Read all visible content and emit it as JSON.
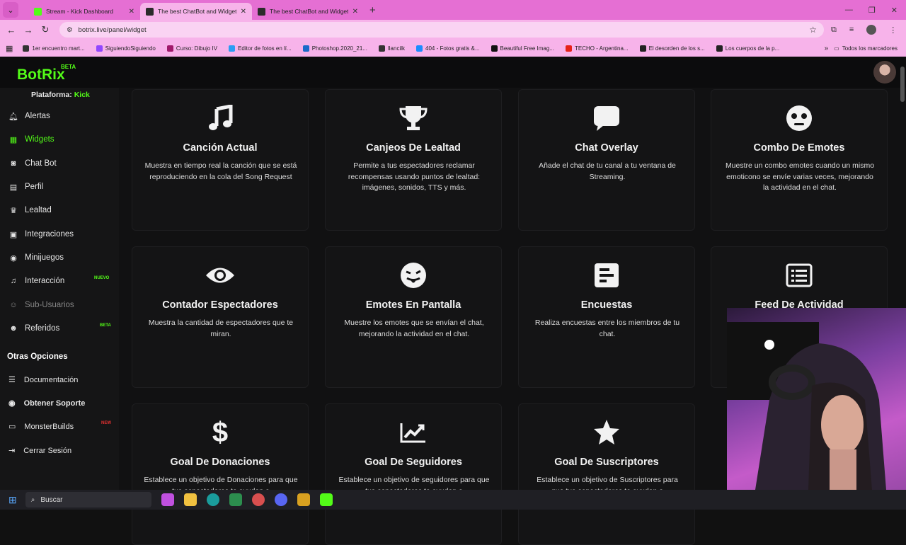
{
  "browser": {
    "tabs": [
      {
        "title": "Stream - Kick Dashboard",
        "fav_color": "#53fc18"
      },
      {
        "title": "The best ChatBot and Widgets",
        "fav_color": "#2b2b2b"
      },
      {
        "title": "The best ChatBot and Widgets",
        "fav_color": "#2b2b2b"
      }
    ],
    "url": "botrix.live/panel/widget",
    "bookmarks": [
      {
        "label": "1er encuentro mart...",
        "color": "#333"
      },
      {
        "label": "SiguiendoSiguiendo",
        "color": "#9146ff"
      },
      {
        "label": "Curso: Dibujo IV",
        "color": "#a0186b"
      },
      {
        "label": "Editor de fotos en lí...",
        "color": "#2a9df4"
      },
      {
        "label": "Photoshop.2020_21...",
        "color": "#1b6ac9"
      },
      {
        "label": "llancilk",
        "color": "#333"
      },
      {
        "label": "404 - Fotos gratis &...",
        "color": "#1a8cff"
      },
      {
        "label": "Beautiful Free Imag...",
        "color": "#111"
      },
      {
        "label": "TECHO - Argentina...",
        "color": "#e62117"
      },
      {
        "label": "El desorden de los s...",
        "color": "#222"
      },
      {
        "label": "Los cuerpos de la p...",
        "color": "#222"
      }
    ],
    "all_bookmarks": "Todos los marcadores"
  },
  "app": {
    "logo": "BotRix",
    "logo_badge": "BETA",
    "platform_label": "Plataforma:",
    "platform_value": "Kick",
    "sidebar": [
      {
        "label": "Alertas",
        "icon": "bell-icon"
      },
      {
        "label": "Widgets",
        "icon": "layers-icon",
        "active": true
      },
      {
        "label": "Chat Bot",
        "icon": "robot-icon"
      },
      {
        "label": "Perfil",
        "icon": "id-card-icon"
      },
      {
        "label": "Lealtad",
        "icon": "trophy-icon"
      },
      {
        "label": "Integraciones",
        "icon": "plug-icon"
      },
      {
        "label": "Minijuegos",
        "icon": "gamepad-icon"
      },
      {
        "label": "Interacción",
        "icon": "music-icon",
        "badge": "NUEVO",
        "badge_color": "#53fc18"
      },
      {
        "label": "Sub-Usuarios",
        "icon": "users-icon",
        "dim": true
      },
      {
        "label": "Referidos",
        "icon": "users-icon",
        "badge": "BETA",
        "badge_color": "#53fc18"
      }
    ],
    "otras_title": "Otras Opciones",
    "otras": [
      {
        "label": "Documentación",
        "icon": "book-icon"
      },
      {
        "label": "Obtener Soporte",
        "icon": "support-icon",
        "bold": true
      },
      {
        "label": "MonsterBuilds",
        "icon": "monitor-icon",
        "badge": "NEW",
        "badge_color": "#e03030"
      },
      {
        "label": "Cerrar Sesión",
        "icon": "logout-icon"
      }
    ],
    "cards": [
      {
        "title": "Canción Actual",
        "desc": "Muestra en tiempo real la canción que se está reproduciendo en la cola del Song Request",
        "icon": "music-note-icon"
      },
      {
        "title": "Canjeos De Lealtad",
        "desc": "Permite a tus espectadores reclamar recompensas usando puntos de lealtad: imágenes, sonidos, TTS y más.",
        "icon": "trophy-icon"
      },
      {
        "title": "Chat Overlay",
        "desc": "Añade el chat de tu canal a tu ventana de Streaming.",
        "icon": "chat-bubble-icon"
      },
      {
        "title": "Combo De Emotes",
        "desc": "Muestre un combo emotes cuando un mismo emoticono se envíe varias veces, mejorando la actividad en el chat.",
        "icon": "emote-face-icon"
      },
      {
        "title": "Contador Espectadores",
        "desc": "Muestra la cantidad de espectadores que te miran.",
        "icon": "eye-icon"
      },
      {
        "title": "Emotes En Pantalla",
        "desc": "Muestre los emotes que se envían el chat, mejorando la actividad en el chat.",
        "icon": "tongue-emoji-icon"
      },
      {
        "title": "Encuestas",
        "desc": "Realiza encuestas entre los miembros de tu chat.",
        "icon": "poll-icon"
      },
      {
        "title": "Feed De Actividad",
        "desc": "",
        "icon": "list-icon"
      },
      {
        "title": "Goal De Donaciones",
        "desc": "Establece un objetivo de Donaciones para que tus espectadores te ayuden a",
        "icon": "dollar-icon"
      },
      {
        "title": "Goal De Seguidores",
        "desc": "Establece un objetivo de seguidores para que tus espectadores te ayuden a",
        "icon": "chart-line-icon"
      },
      {
        "title": "Goal De Suscriptores",
        "desc": "Establece un objetivo de Suscriptores para que tus espectadores te ayuden a",
        "icon": "star-icon"
      }
    ]
  },
  "taskbar": {
    "search_placeholder": "Buscar"
  }
}
